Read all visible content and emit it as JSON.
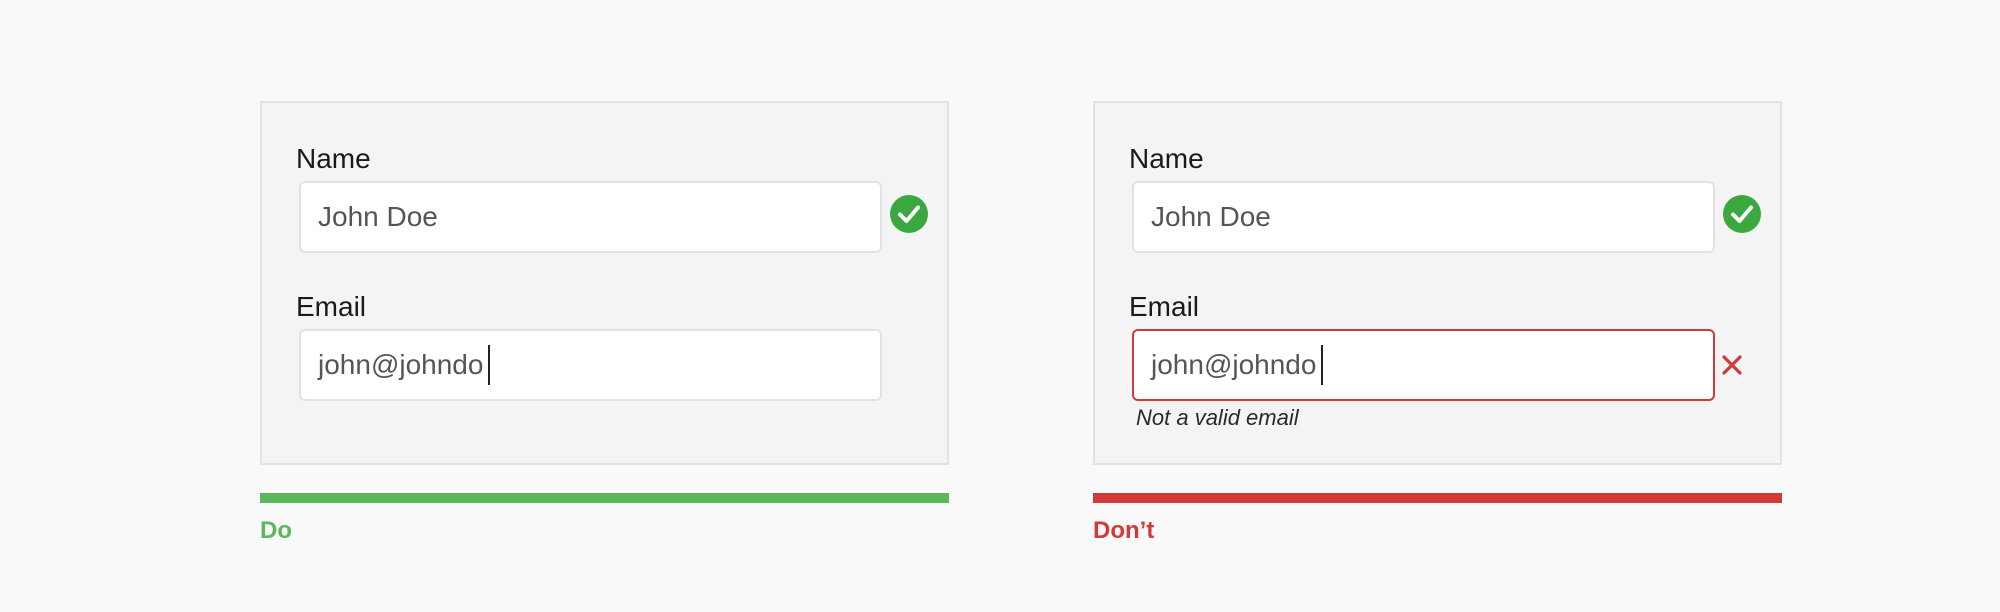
{
  "do_example": {
    "name_label": "Name",
    "name_value": "John Doe",
    "email_label": "Email",
    "email_value": "john@johndo",
    "verdict": "Do"
  },
  "dont_example": {
    "name_label": "Name",
    "name_value": "John Doe",
    "email_label": "Email",
    "email_value": "john@johndo",
    "error_message": "Not a valid email",
    "verdict": "Don’t"
  },
  "colors": {
    "success": "#5cb85c",
    "check_fill": "#3aa83f",
    "error": "#d13a3a"
  },
  "icons": [
    "check-circle-icon",
    "close-icon"
  ]
}
